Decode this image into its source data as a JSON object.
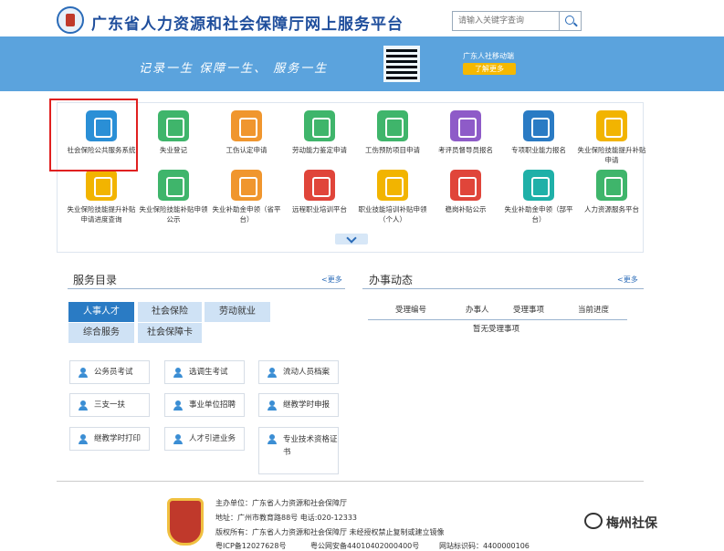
{
  "header": {
    "title": "广东省人力资源和社会保障厅网上服务平台",
    "search_placeholder": "请输入关键字查询"
  },
  "banner": {
    "slogan": "记录一生  保障一生、  服务一生",
    "mobile": "广东人社移动端",
    "more": "了解更多"
  },
  "tiles": [
    {
      "label": "社会保险公共服务系统",
      "color": "#2a8fd6"
    },
    {
      "label": "失业登记",
      "color": "#3fb56b"
    },
    {
      "label": "工伤认定申请",
      "color": "#f0962e"
    },
    {
      "label": "劳动能力鉴定申请",
      "color": "#3fb56b"
    },
    {
      "label": "工伤预防项目申请",
      "color": "#3fb56b"
    },
    {
      "label": "考评员督导员报名",
      "color": "#8e5bc8"
    },
    {
      "label": "专项职业能力报名",
      "color": "#2a7bc4"
    },
    {
      "label": "失业保险技能提升补贴申请",
      "color": "#f2b400"
    },
    {
      "label": "失业保险技能提升补贴申请进度查询",
      "color": "#f2b400"
    },
    {
      "label": "失业保险技能补贴申领公示",
      "color": "#3fb56b"
    },
    {
      "label": "失业补助金申领（省平台）",
      "color": "#f0962e"
    },
    {
      "label": "远程职业培训平台",
      "color": "#e0453a"
    },
    {
      "label": "职业技能培训补贴申领（个人）",
      "color": "#f2b400"
    },
    {
      "label": "稳岗补贴公示",
      "color": "#e0453a"
    },
    {
      "label": "失业补助金申领（部平台）",
      "color": "#1fb0a8"
    },
    {
      "label": "人力资源服务平台",
      "color": "#3fb56b"
    }
  ],
  "catalog": {
    "title": "服务目录",
    "more": "<更多",
    "tabs": [
      "人事人才",
      "社会保险",
      "劳动就业",
      "综合服务",
      "社会保障卡"
    ],
    "items": [
      "公务员考试",
      "选调生考试",
      "流动人员档案",
      "三支一扶",
      "事业单位招聘",
      "继教学时申报",
      "继教学时打印",
      "人才引进业务",
      "专业技术资格证书"
    ]
  },
  "news": {
    "title": "办事动态",
    "more": "<更多",
    "columns": [
      "受理编号",
      "办事人",
      "受理事项",
      "当前进度"
    ],
    "empty": "暂无受理事项"
  },
  "footer": {
    "host": "主办单位：广东省人力资源和社会保障厅",
    "addr": "地址：广州市教育路88号 电话:020-12333",
    "copy": "版权所有：广东省人力资源和社会保障厅 未经授权禁止复制或建立镜像",
    "icp": "粤ICP备12027628号",
    "police": "粤公网安备44010402000400号",
    "code": "网站标识码：4400000106",
    "watermark": "梅州社保"
  }
}
